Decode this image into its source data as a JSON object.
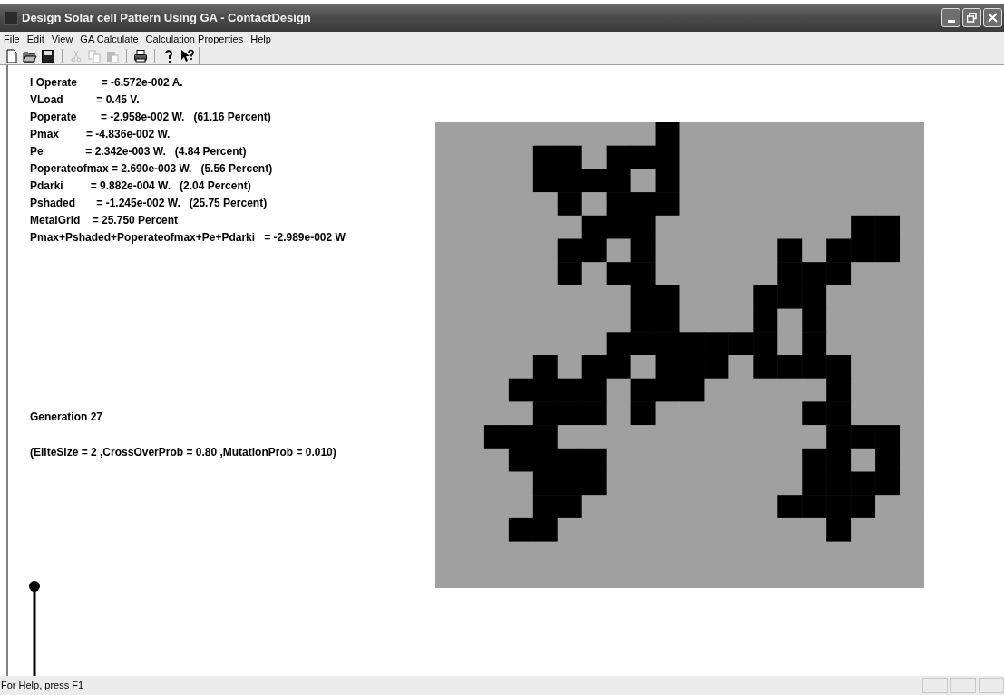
{
  "window": {
    "title": "Design Solar cell Pattern Using GA - ContactDesign"
  },
  "menu": [
    "File",
    "Edit",
    "View",
    "GA Calculate",
    "Calculation Properties",
    "Help"
  ],
  "toolbar": [
    {
      "kind": "new",
      "disabled": false
    },
    {
      "kind": "open",
      "disabled": false
    },
    {
      "kind": "save",
      "disabled": false
    },
    {
      "kind": "separator"
    },
    {
      "kind": "cut",
      "disabled": true
    },
    {
      "kind": "copy",
      "disabled": true
    },
    {
      "kind": "paste",
      "disabled": true
    },
    {
      "kind": "separator"
    },
    {
      "kind": "print",
      "disabled": false
    },
    {
      "kind": "separator"
    },
    {
      "kind": "about",
      "disabled": false
    },
    {
      "kind": "context-help",
      "disabled": false
    }
  ],
  "results": [
    "I Operate        = -6.572e-002 A.",
    "VLoad           = 0.45 V.",
    "Poperate        = -2.958e-002 W.   (61.16 Percent)",
    "Pmax         = -4.836e-002 W.",
    "Pe              = 2.342e-003 W.   (4.84 Percent)",
    "Poperateofmax = 2.690e-003 W.   (5.56 Percent)",
    "Pdarki         = 9.882e-004 W.   (2.04 Percent)",
    "Pshaded       = -1.245e-002 W.   (25.75 Percent)",
    "MetalGrid    = 25.750 Percent",
    "Pmax+Pshaded+Poperateofmax+Pe+Pdarki   = -2.989e-002 W"
  ],
  "generation": "Generation 27",
  "parameters": "(EliteSize = 2 ,CrossOverProb = 0.80 ,MutationProb = 0.010)",
  "pattern": [
    [
      false,
      false,
      false,
      false,
      false,
      false,
      false,
      false,
      false,
      true,
      false,
      false,
      false,
      false,
      false,
      false,
      false,
      false,
      false,
      false
    ],
    [
      false,
      false,
      false,
      false,
      true,
      true,
      false,
      true,
      true,
      true,
      false,
      false,
      false,
      false,
      false,
      false,
      false,
      false,
      false,
      false
    ],
    [
      false,
      false,
      false,
      false,
      true,
      true,
      true,
      true,
      false,
      true,
      false,
      false,
      false,
      false,
      false,
      false,
      false,
      false,
      false,
      false
    ],
    [
      false,
      false,
      false,
      false,
      false,
      true,
      false,
      true,
      true,
      true,
      false,
      false,
      false,
      false,
      false,
      false,
      false,
      false,
      false,
      false
    ],
    [
      false,
      false,
      false,
      false,
      false,
      false,
      true,
      true,
      true,
      false,
      false,
      false,
      false,
      false,
      false,
      false,
      false,
      true,
      true,
      false
    ],
    [
      false,
      false,
      false,
      false,
      false,
      true,
      true,
      false,
      true,
      false,
      false,
      false,
      false,
      false,
      true,
      false,
      true,
      true,
      true,
      false
    ],
    [
      false,
      false,
      false,
      false,
      false,
      true,
      false,
      true,
      true,
      false,
      false,
      false,
      false,
      false,
      true,
      true,
      true,
      false,
      false,
      false
    ],
    [
      false,
      false,
      false,
      false,
      false,
      false,
      false,
      false,
      true,
      true,
      false,
      false,
      false,
      true,
      true,
      true,
      false,
      false,
      false,
      false
    ],
    [
      false,
      false,
      false,
      false,
      false,
      false,
      false,
      false,
      true,
      true,
      false,
      false,
      false,
      true,
      false,
      true,
      false,
      false,
      false,
      false
    ],
    [
      false,
      false,
      false,
      false,
      false,
      false,
      false,
      true,
      true,
      true,
      true,
      true,
      true,
      true,
      false,
      true,
      false,
      false,
      false,
      false
    ],
    [
      false,
      false,
      false,
      false,
      true,
      false,
      true,
      true,
      false,
      true,
      true,
      true,
      false,
      true,
      true,
      true,
      true,
      false,
      false,
      false
    ],
    [
      false,
      false,
      false,
      true,
      true,
      true,
      true,
      false,
      true,
      true,
      true,
      false,
      false,
      false,
      false,
      false,
      true,
      false,
      false,
      false
    ],
    [
      false,
      false,
      false,
      false,
      true,
      true,
      true,
      false,
      true,
      false,
      false,
      false,
      false,
      false,
      false,
      true,
      true,
      false,
      false,
      false
    ],
    [
      false,
      false,
      true,
      true,
      true,
      false,
      false,
      false,
      false,
      false,
      false,
      false,
      false,
      false,
      false,
      false,
      true,
      true,
      true,
      false
    ],
    [
      false,
      false,
      false,
      true,
      true,
      true,
      true,
      false,
      false,
      false,
      false,
      false,
      false,
      false,
      false,
      true,
      true,
      false,
      true,
      false
    ],
    [
      false,
      false,
      false,
      false,
      true,
      true,
      true,
      false,
      false,
      false,
      false,
      false,
      false,
      false,
      false,
      true,
      true,
      true,
      true,
      false
    ],
    [
      false,
      false,
      false,
      false,
      true,
      true,
      false,
      false,
      false,
      false,
      false,
      false,
      false,
      false,
      true,
      true,
      true,
      true,
      false,
      false
    ],
    [
      false,
      false,
      false,
      true,
      true,
      false,
      false,
      false,
      false,
      false,
      false,
      false,
      false,
      false,
      false,
      false,
      true,
      false,
      false,
      false
    ],
    [
      false,
      false,
      false,
      false,
      false,
      false,
      false,
      false,
      false,
      false,
      false,
      false,
      false,
      false,
      false,
      false,
      false,
      false,
      false,
      false
    ],
    [
      false,
      false,
      false,
      false,
      false,
      false,
      false,
      false,
      false,
      false,
      false,
      false,
      false,
      false,
      false,
      false,
      false,
      false,
      false,
      false
    ]
  ],
  "status_bar": {
    "text": "For Help, press F1"
  }
}
